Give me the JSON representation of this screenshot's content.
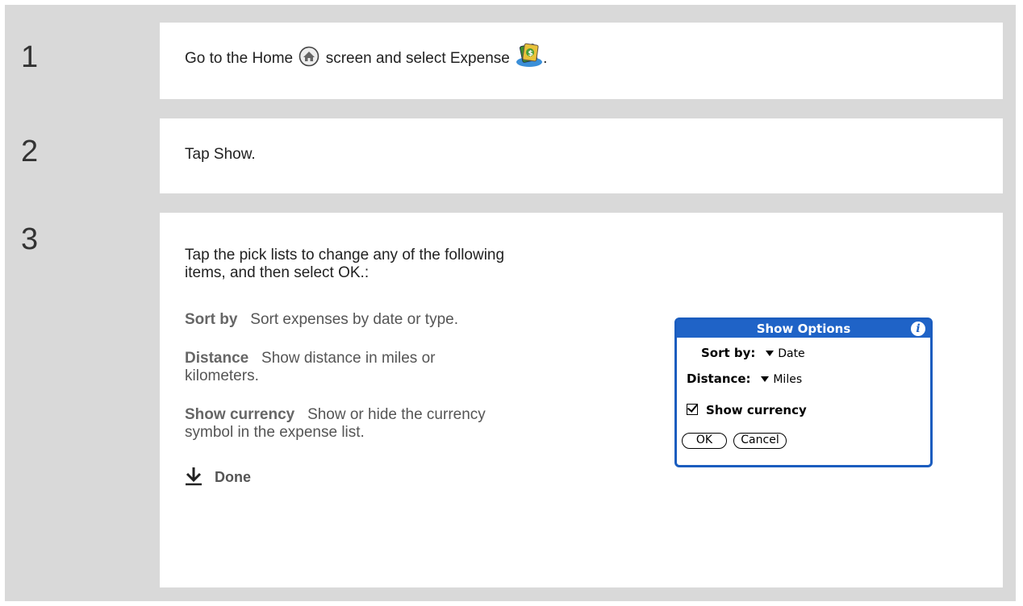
{
  "steps": [
    {
      "number": "1",
      "text_before_home": "Go to the Home",
      "text_after_home": "screen and select Expense",
      "text_end": "."
    },
    {
      "number": "2",
      "text": "Tap Show."
    },
    {
      "number": "3",
      "intro_line1": "Tap the pick lists to change any of the following",
      "intro_line2": "items, and then select OK.:",
      "items": [
        {
          "term": "Sort by",
          "desc_line1": "Sort expenses by date or type.",
          "desc_line2": ""
        },
        {
          "term": "Distance",
          "desc_line1": "Show distance in miles or",
          "desc_line2": "kilometers."
        },
        {
          "term": "Show currency",
          "desc_line1": "Show or hide the currency",
          "desc_line2": "symbol in the expense list."
        }
      ],
      "done_label": "Done"
    }
  ],
  "dialog": {
    "title": "Show Options",
    "info_glyph": "i",
    "sort_label": "Sort by:",
    "sort_value": "Date",
    "distance_label": "Distance:",
    "distance_value": "Miles",
    "currency_label": "Show currency",
    "currency_checked": true,
    "ok_label": "OK",
    "cancel_label": "Cancel"
  },
  "colors": {
    "panel_bg": "#d9d9d9",
    "dialog_border": "#1b5dbf",
    "dialog_title_bg": "#1f63c7"
  },
  "icons": [
    "home-icon",
    "expense-app-icon",
    "info-icon",
    "down-arrow-icon",
    "checkbox-checked-icon",
    "triangle-dropdown-icon"
  ]
}
